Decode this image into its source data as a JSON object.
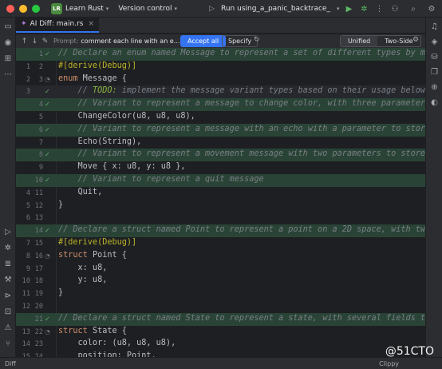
{
  "titlebar": {
    "project_badge": "LR",
    "project_name": "Learn Rust",
    "version_control": "Version control",
    "run_config": "Run using_a_panic_backtrace_"
  },
  "tab": {
    "label": "AI Diff: main.rs"
  },
  "diff_toolbar": {
    "prompt_label": "Prompt:",
    "prompt_value": "comment each line with an e...",
    "accept_all": "Accept all",
    "specify": "Specify",
    "view_unified": "Unified",
    "view_two_side": "Two-Side"
  },
  "editor": {
    "lines": [
      {
        "ln1": "",
        "ln2": "1",
        "mark": "check",
        "type": "added",
        "code": "// Declare an enum named Message to represent a set of different types by messages"
      },
      {
        "ln1": "1",
        "ln2": "2",
        "mark": "",
        "type": "",
        "code": "#[derive(Debug)]"
      },
      {
        "ln1": "2",
        "ln2": "3",
        "mark": "impl",
        "type": "",
        "code": "enum Message {"
      },
      {
        "ln1": "3",
        "ln2": "",
        "mark": "check",
        "type": "cursor",
        "code": "    // TODO: implement the message variant types based on their usage below"
      },
      {
        "ln1": "",
        "ln2": "4",
        "mark": "check",
        "type": "added",
        "code": "    // Variant to represent a message to change color, with three parameters to store"
      },
      {
        "ln1": "",
        "ln2": "5",
        "mark": "",
        "type": "",
        "code": "    ChangeColor(u8, u8, u8),"
      },
      {
        "ln1": "",
        "ln2": "6",
        "mark": "check",
        "type": "added",
        "code": "    // Variant to represent a message with an echo with a parameter to store the message"
      },
      {
        "ln1": "",
        "ln2": "7",
        "mark": "",
        "type": "",
        "code": "    Echo(String),"
      },
      {
        "ln1": "",
        "ln2": "8",
        "mark": "check",
        "type": "added",
        "code": "    // Variant to represent a movement message with two parameters to store coordinates"
      },
      {
        "ln1": "",
        "ln2": "9",
        "mark": "",
        "type": "",
        "code": "    Move { x: u8, y: u8 },"
      },
      {
        "ln1": "",
        "ln2": "10",
        "mark": "check",
        "type": "added",
        "code": "    // Variant to represent a quit message"
      },
      {
        "ln1": "4",
        "ln2": "11",
        "mark": "",
        "type": "",
        "code": "    Quit,"
      },
      {
        "ln1": "5",
        "ln2": "12",
        "mark": "",
        "type": "",
        "code": "}"
      },
      {
        "ln1": "6",
        "ln2": "13",
        "mark": "",
        "type": "",
        "code": ""
      },
      {
        "ln1": "",
        "ln2": "14",
        "mark": "check",
        "type": "added",
        "code": "// Declare a struct named Point to represent a point on a 2D space, with two fields"
      },
      {
        "ln1": "7",
        "ln2": "15",
        "mark": "",
        "type": "",
        "code": "#[derive(Debug)]"
      },
      {
        "ln1": "8",
        "ln2": "16",
        "mark": "impl",
        "type": "",
        "code": "struct Point {"
      },
      {
        "ln1": "9",
        "ln2": "17",
        "mark": "",
        "type": "",
        "code": "    x: u8,"
      },
      {
        "ln1": "10",
        "ln2": "18",
        "mark": "",
        "type": "",
        "code": "    y: u8,"
      },
      {
        "ln1": "11",
        "ln2": "19",
        "mark": "",
        "type": "",
        "code": "}"
      },
      {
        "ln1": "12",
        "ln2": "20",
        "mark": "",
        "type": "",
        "code": ""
      },
      {
        "ln1": "",
        "ln2": "21",
        "mark": "check",
        "type": "added",
        "code": "// Declare a struct named State to represent a state, with several fields to store"
      },
      {
        "ln1": "13",
        "ln2": "22",
        "mark": "impl",
        "type": "",
        "code": "struct State {"
      },
      {
        "ln1": "14",
        "ln2": "23",
        "mark": "",
        "type": "",
        "code": "    color: (u8, u8, u8),"
      },
      {
        "ln1": "15",
        "ln2": "24",
        "mark": "",
        "type": "",
        "code": "    position: Point,"
      }
    ]
  },
  "statusbar": {
    "left": "Diff",
    "right": "Clippy"
  },
  "watermark": "@51CTO",
  "colors": {
    "accent": "#3574f0",
    "added_bg": "#294436",
    "comment": "#7a7e85",
    "keyword": "#cf8e6d"
  }
}
